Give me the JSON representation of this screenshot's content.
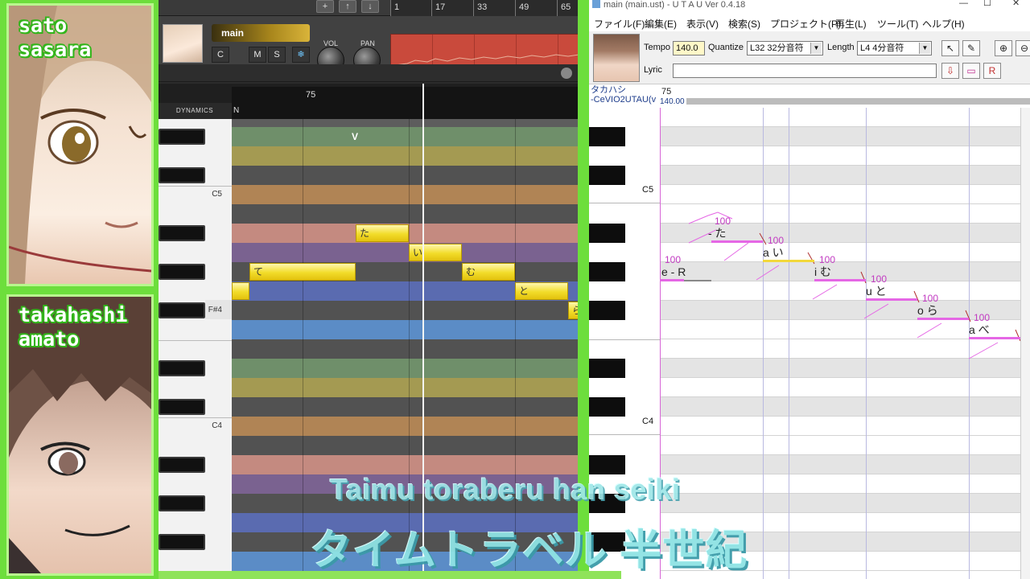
{
  "overlay": {
    "char1_name_line1": "sato",
    "char1_name_line2": "sasara",
    "char2_name_line1": "takahashi",
    "char2_name_line2": "amato",
    "accent_green": "#6dde3c"
  },
  "cevio": {
    "ruler_labels": [
      "1",
      "17",
      "33",
      "49",
      "65"
    ],
    "track_name": "main",
    "btn_c": "C",
    "btn_m": "M",
    "btn_s": "S",
    "btn_snow": "❄",
    "vol_label": "VOL",
    "pan_label": "PAN",
    "dynamics_label": "DYNAMICS",
    "roll_measure": "75",
    "roll_note_label": "N",
    "key_c5": "C5",
    "key_fs4": "F#4",
    "key_c4": "C4",
    "marker_v": "V",
    "notes": [
      {
        "lyric": "た"
      },
      {
        "lyric": "い"
      },
      {
        "lyric": "て"
      },
      {
        "lyric": "む"
      },
      {
        "lyric": ""
      },
      {
        "lyric": "と"
      },
      {
        "lyric": "ら"
      }
    ],
    "note_color": "#f2dc2a"
  },
  "utau": {
    "title": "main (main.ust) - U T A U Ver 0.4.18",
    "menu": [
      "ファイル(F)",
      "編集(E)",
      "表示(V)",
      "検索(S)",
      "プロジェクト(P)",
      "再生(L)",
      "ツール(T)",
      "ヘルプ(H)"
    ],
    "tempo_label": "Tempo",
    "tempo_value": "140.0",
    "quantize_label": "Quantize",
    "quantize_value": "L32 32分音符",
    "length_label": "Length",
    "length_value": "L4  4分音符",
    "lyric_label": "Lyric",
    "lyric_value": "",
    "singer_name": "タカハシ",
    "engine_name": "-CeVIO2UTAU(v",
    "measure_label": "75",
    "tempo_marker": "140.00",
    "key_c5": "C5",
    "key_c4": "C4",
    "notes": [
      {
        "text": "e - R",
        "vel": "100"
      },
      {
        "text": "- た",
        "vel": "100"
      },
      {
        "text": "a い",
        "vel": "100"
      },
      {
        "text": "i む",
        "vel": "100"
      },
      {
        "text": "u と",
        "vel": "100"
      },
      {
        "text": "o ら",
        "vel": "100"
      },
      {
        "text": "a べ",
        "vel": "100"
      }
    ],
    "pitch_color": "#e567e5"
  },
  "subtitles": {
    "romaji": "Taimu toraberu han seiki",
    "japanese": "タイムトラベル 半世紀"
  }
}
